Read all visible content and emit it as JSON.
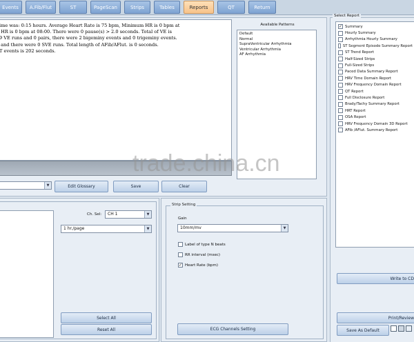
{
  "tabs": [
    {
      "label": "Events",
      "active": false
    },
    {
      "label": "A.Fib/Flut",
      "active": false
    },
    {
      "label": "ST",
      "active": false
    },
    {
      "label": "PageScan",
      "active": false
    },
    {
      "label": "Strips",
      "active": false
    },
    {
      "label": "Tables",
      "active": false
    },
    {
      "label": "Reports",
      "active": true
    },
    {
      "label": "QT",
      "active": false
    },
    {
      "label": "Return",
      "active": false
    }
  ],
  "summary": {
    "lines": [
      "ime was: 0:15 hours. Average Heart Rate is 75 bpm, Minimum HR is 0 bpm at",
      " HR is 0 bpm at 08:00. There were 0 pause(s) > 2.0 seconds. Total of VE is",
      "9 VE runs and 0 pairs, there were 2 bigeminy events and 0 trigeminy events.",
      " and there were 0 SVE runs. Total length of AFib/AFlut. is 0 seconds.",
      "T events is 202 seconds."
    ]
  },
  "patterns": {
    "title": "Available Patterns",
    "items": [
      "Default",
      "Normal",
      "SupraVentricular Arrhythmia",
      "Ventricular Arrhythmia",
      "AF Arrhythmia"
    ]
  },
  "select_report": {
    "title": "Select Report",
    "items": [
      {
        "label": "Summary",
        "checked": true
      },
      {
        "label": "Hourly Summary",
        "checked": false
      },
      {
        "label": "Arrhythmia Hourly Summary",
        "checked": false
      },
      {
        "label": "ST Segment Episode Summary Report",
        "checked": false
      },
      {
        "label": "ST Trend Report",
        "checked": false
      },
      {
        "label": "Half-Sized Strips",
        "checked": false
      },
      {
        "label": "Full-Sized Strips",
        "checked": false
      },
      {
        "label": "Paced Data Summary Report",
        "checked": false
      },
      {
        "label": "HRV Time Domain Report",
        "checked": false
      },
      {
        "label": "HRV Frequency Domain Report",
        "checked": false
      },
      {
        "label": "QT Report",
        "checked": false
      },
      {
        "label": "Full Disclosure Report",
        "checked": false
      },
      {
        "label": "Brady/Tachy Summary Report",
        "checked": false
      },
      {
        "label": "HRT Report",
        "checked": false
      },
      {
        "label": "OSA Report",
        "checked": false
      },
      {
        "label": "HRV Frequency Domain 3D Report",
        "checked": false
      },
      {
        "label": "AFib /AFlut. Summary Report",
        "checked": false
      }
    ],
    "write_label": "Write to CD",
    "print_label": "Print/Review",
    "save_default_label": "Save As Default"
  },
  "glossary": {
    "edit_label": "Edit Glossary",
    "save_label": "Save",
    "clear_label": "Clear"
  },
  "channel": {
    "ch_label": "Ch. Sel:",
    "ch_value": "CH 1",
    "page_value": "1 hr./page",
    "select_all_label": "Select All",
    "reset_all_label": "Reset All"
  },
  "strip_setting": {
    "title": "Strip Setting",
    "gain_label": "Gain",
    "gain_value": "10mm/mv",
    "options": [
      {
        "label": "Label of type N beats",
        "checked": false
      },
      {
        "label": "RR interval (msec)",
        "checked": false
      },
      {
        "label": "Heart Rate (bpm)",
        "checked": true
      }
    ],
    "ecg_channels_label": "ECG Channels Setting"
  },
  "watermark": "trade.china.cn",
  "colors": {
    "tab_active": "#f7c38a",
    "tab_normal": "#7ea3d2",
    "panel_bg": "#e8eef5"
  }
}
